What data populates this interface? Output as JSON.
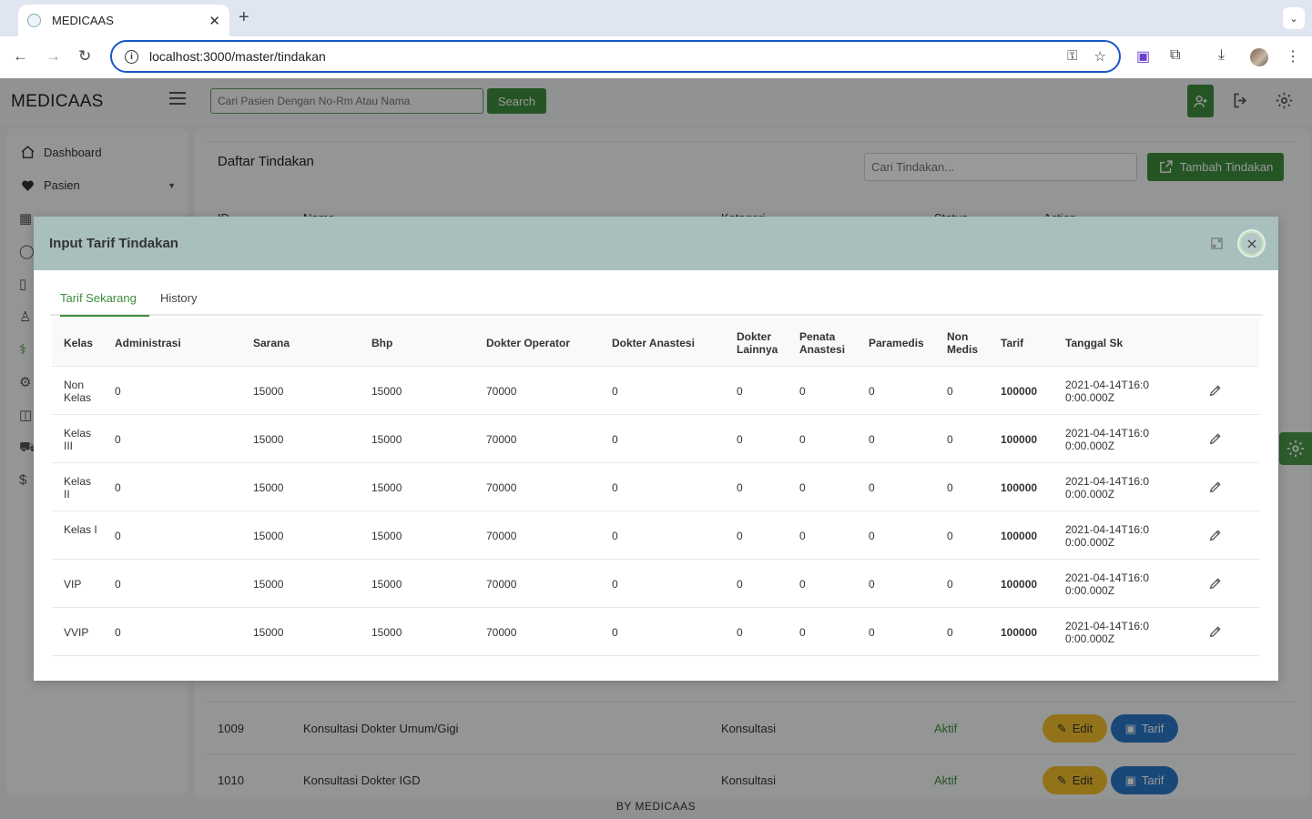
{
  "browser": {
    "tab_title": "MEDICAAS",
    "url": "localhost:3000/master/tindakan"
  },
  "app": {
    "brand": "MEDICAAS",
    "patient_search_placeholder": "Cari Pasien Dengan No-Rm Atau Nama",
    "search_button": "Search",
    "footer": "BY  MEDICAAS"
  },
  "sidebar": {
    "items": [
      {
        "label": "Dashboard",
        "icon": "home-icon"
      },
      {
        "label": "Pasien",
        "icon": "heart-icon"
      }
    ]
  },
  "page": {
    "title": "Daftar Tindakan",
    "search_placeholder": "Cari Tindakan...",
    "add_button": "Tambah Tindakan",
    "columns": [
      "ID",
      "Nama",
      "Kategori",
      "Status",
      "Action"
    ],
    "rows": [
      {
        "id": "1009",
        "nama": "Konsultasi Dokter Umum/Gigi",
        "kategori": "Konsultasi",
        "status": "Aktif",
        "edit": "Edit",
        "tarif": "Tarif"
      },
      {
        "id": "1010",
        "nama": "Konsultasi Dokter IGD",
        "kategori": "Konsultasi",
        "status": "Aktif",
        "edit": "Edit",
        "tarif": "Tarif"
      }
    ]
  },
  "modal": {
    "title": "Input Tarif Tindakan",
    "tabs": [
      "Tarif Sekarang",
      "History"
    ],
    "columns": [
      "Kelas",
      "Administrasi",
      "Sarana",
      "Bhp",
      "Dokter Operator",
      "Dokter Anastesi",
      "Dokter Lainnya",
      "Penata Anastesi",
      "Paramedis",
      "Non Medis",
      "Tarif",
      "Tanggal Sk"
    ],
    "rows": [
      {
        "kelas": "Non Kelas",
        "administrasi": "0",
        "sarana": "15000",
        "bhp": "15000",
        "dokter_operator": "70000",
        "dokter_anastesi": "0",
        "dokter_lainnya": "0",
        "penata_anastesi": "0",
        "paramedis": "0",
        "non_medis": "0",
        "tarif": "100000",
        "tanggal_sk": "2021-04-14T16:00:00.000Z"
      },
      {
        "kelas": "Kelas III",
        "administrasi": "0",
        "sarana": "15000",
        "bhp": "15000",
        "dokter_operator": "70000",
        "dokter_anastesi": "0",
        "dokter_lainnya": "0",
        "penata_anastesi": "0",
        "paramedis": "0",
        "non_medis": "0",
        "tarif": "100000",
        "tanggal_sk": "2021-04-14T16:00:00.000Z"
      },
      {
        "kelas": "Kelas II",
        "administrasi": "0",
        "sarana": "15000",
        "bhp": "15000",
        "dokter_operator": "70000",
        "dokter_anastesi": "0",
        "dokter_lainnya": "0",
        "penata_anastesi": "0",
        "paramedis": "0",
        "non_medis": "0",
        "tarif": "100000",
        "tanggal_sk": "2021-04-14T16:00:00.000Z"
      },
      {
        "kelas": "Kelas I",
        "administrasi": "0",
        "sarana": "15000",
        "bhp": "15000",
        "dokter_operator": "70000",
        "dokter_anastesi": "0",
        "dokter_lainnya": "0",
        "penata_anastesi": "0",
        "paramedis": "0",
        "non_medis": "0",
        "tarif": "100000",
        "tanggal_sk": "2021-04-14T16:00:00.000Z"
      },
      {
        "kelas": "VIP",
        "administrasi": "0",
        "sarana": "15000",
        "bhp": "15000",
        "dokter_operator": "70000",
        "dokter_anastesi": "0",
        "dokter_lainnya": "0",
        "penata_anastesi": "0",
        "paramedis": "0",
        "non_medis": "0",
        "tarif": "100000",
        "tanggal_sk": "2021-04-14T16:00:00.000Z"
      },
      {
        "kelas": "VVIP",
        "administrasi": "0",
        "sarana": "15000",
        "bhp": "15000",
        "dokter_operator": "70000",
        "dokter_anastesi": "0",
        "dokter_lainnya": "0",
        "penata_anastesi": "0",
        "paramedis": "0",
        "non_medis": "0",
        "tarif": "100000",
        "tanggal_sk": "2021-04-14T16:00:00.000Z"
      }
    ]
  },
  "colors": {
    "primary_green": "#3e8e3e",
    "modal_header": "#a8bfbe",
    "edit_yellow": "#f5c02a",
    "tarif_blue": "#2a78c8"
  }
}
